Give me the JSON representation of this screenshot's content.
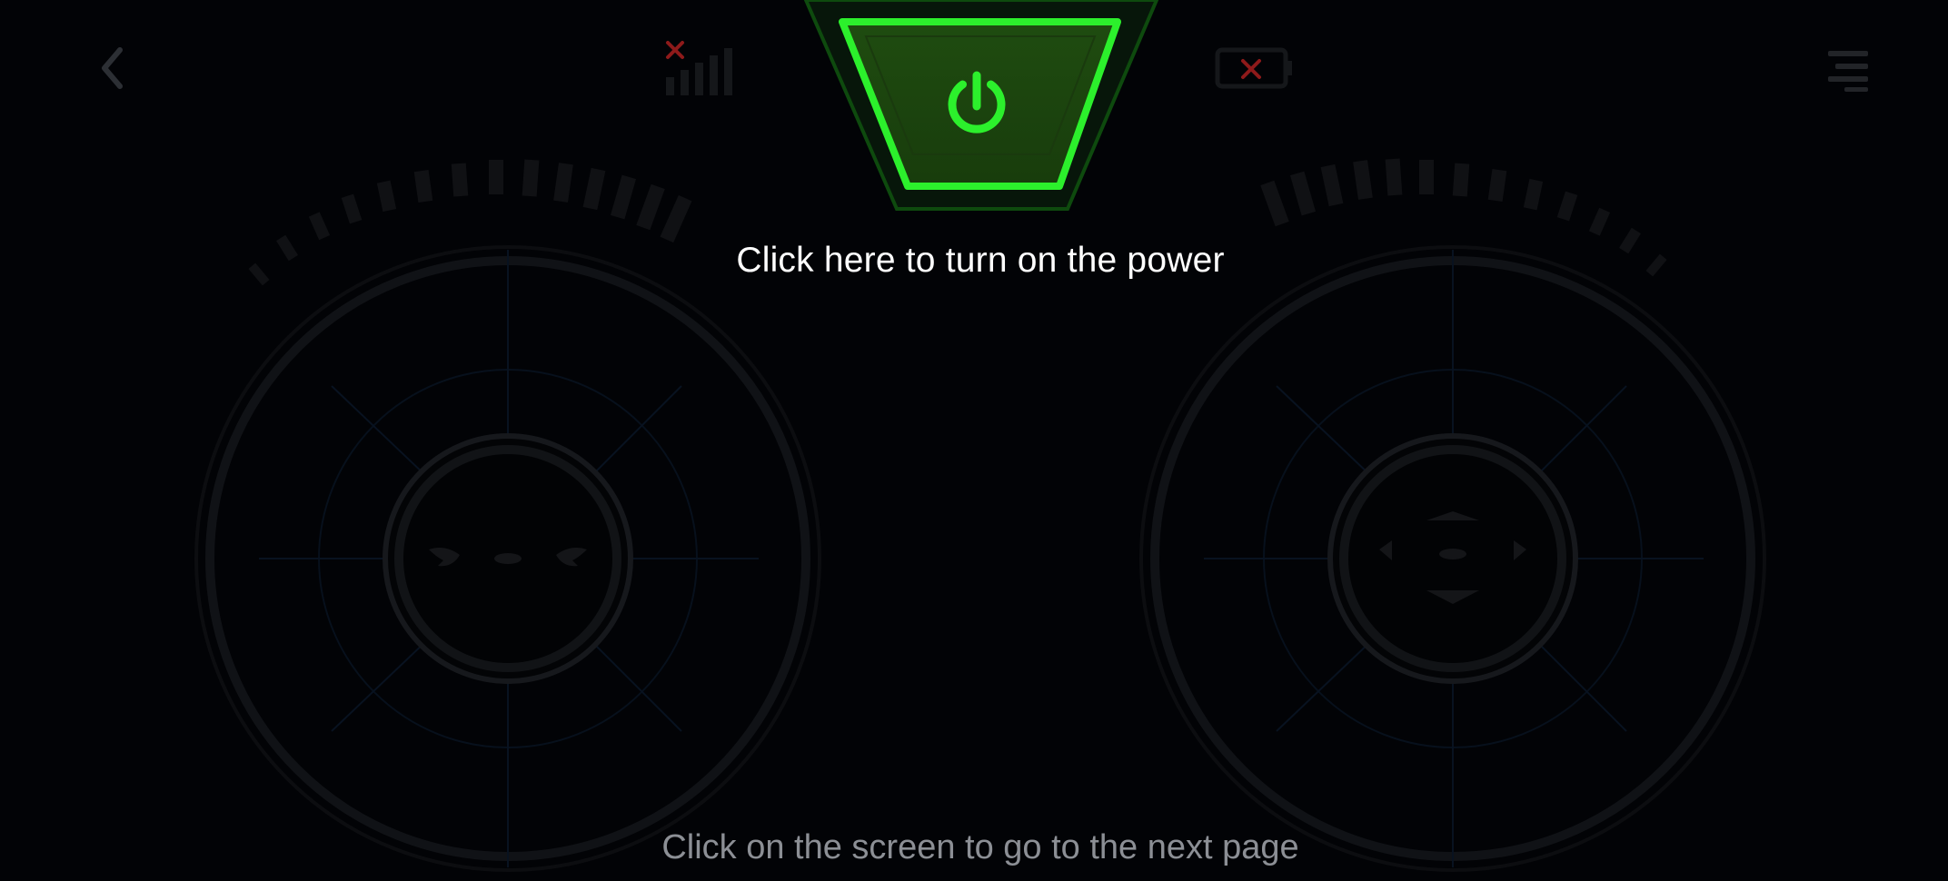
{
  "header": {
    "back_icon": "chevron-left-icon",
    "menu_icon": "menu-lines-icon",
    "signal_icon": "signal-bars-icon",
    "signal_status_icon": "red-x-icon",
    "battery_icon": "battery-icon",
    "battery_status_icon": "red-x-icon"
  },
  "power": {
    "icon": "power-icon",
    "hint": "Click here to turn on the power"
  },
  "joysticks": {
    "left": {
      "icon": "rotate-arrows-icon"
    },
    "right": {
      "icon": "direction-arrows-icon"
    }
  },
  "footer": {
    "hint": "Click on the screen to go to the next page"
  },
  "colors": {
    "background": "#020306",
    "power_green": "#22ee22",
    "power_fill": "#1d4a10",
    "dim_gray": "#2a2c30",
    "status_red": "#b02020",
    "footer_text": "#8c8f95",
    "grid_blue": "#0d1a2e"
  }
}
